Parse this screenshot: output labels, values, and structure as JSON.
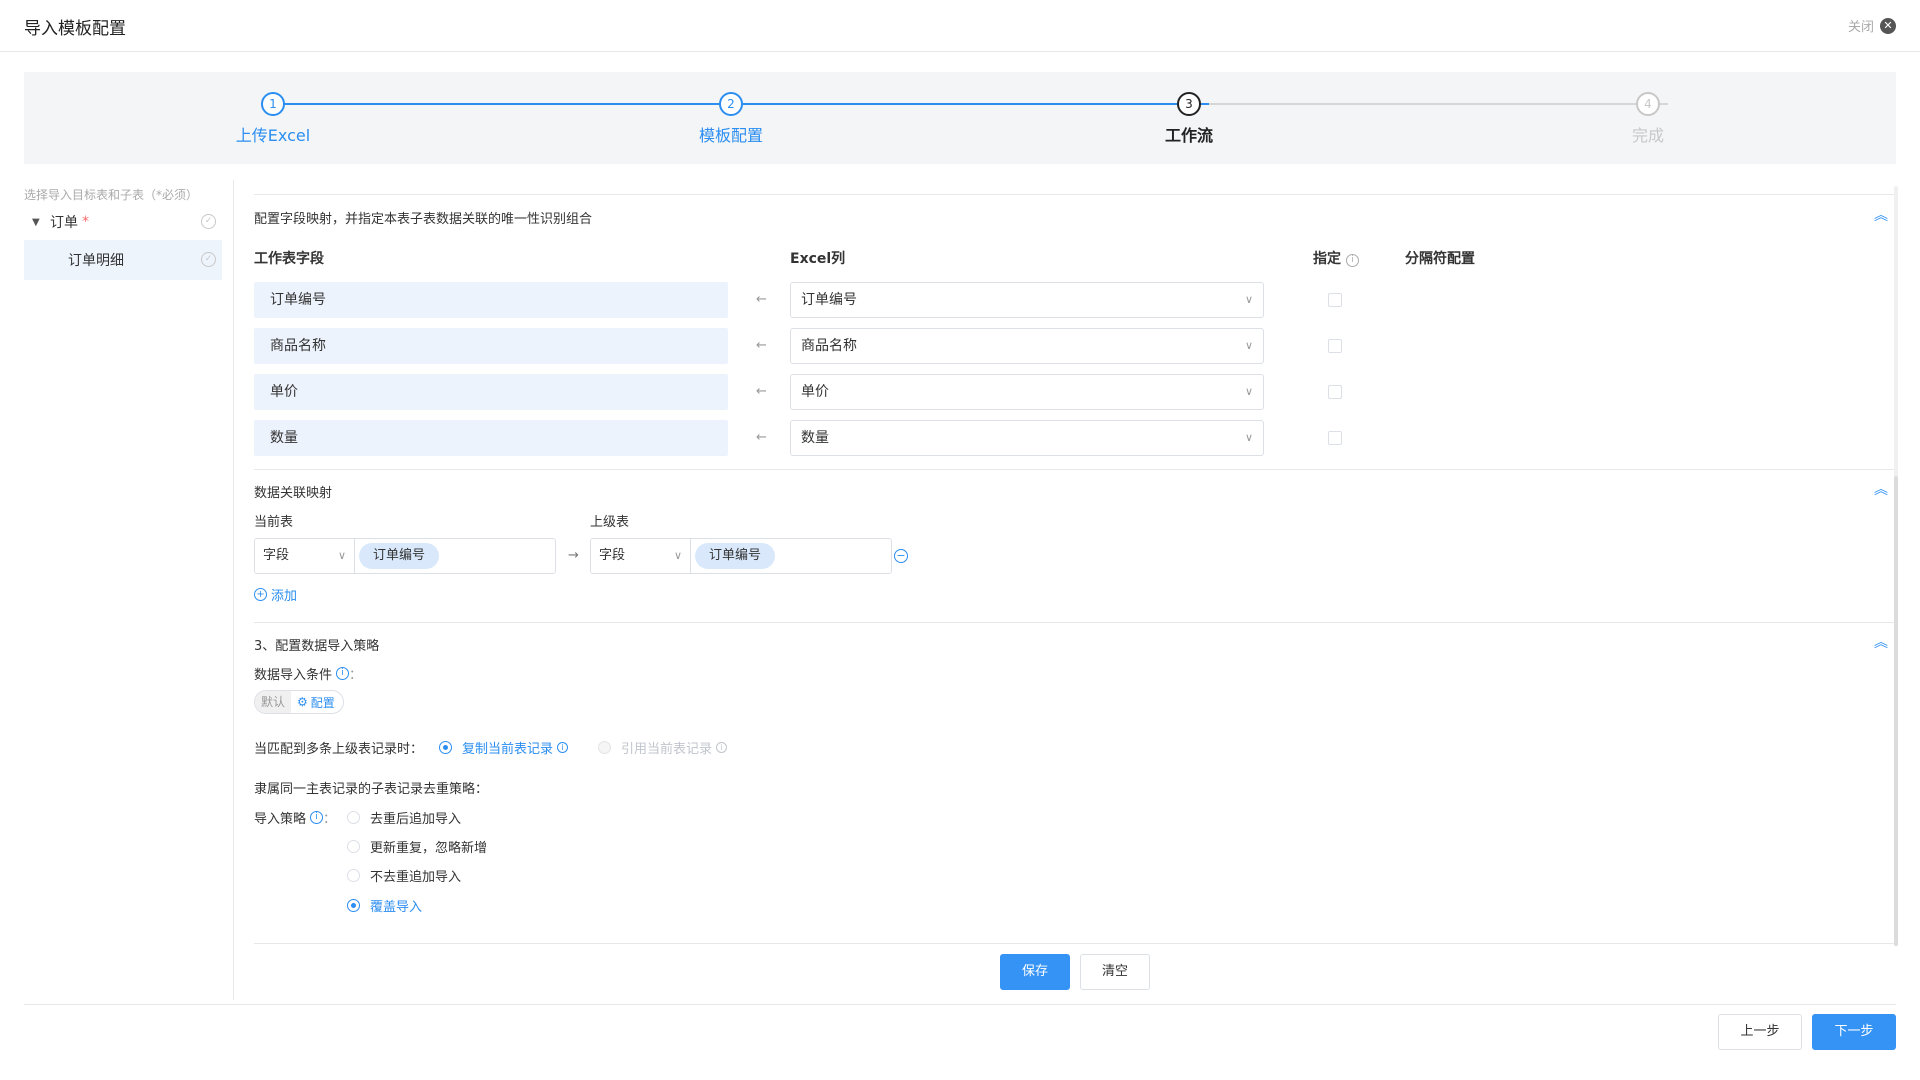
{
  "header": {
    "title": "导入模板配置",
    "close_label": "关闭",
    "close_icon": "close-circle-icon"
  },
  "steps": [
    {
      "num": "1",
      "label": "上传Excel",
      "state": "done"
    },
    {
      "num": "2",
      "label": "模板配置",
      "state": "done"
    },
    {
      "num": "3",
      "label": "工作流",
      "state": "current"
    },
    {
      "num": "4",
      "label": "完成",
      "state": "pending"
    }
  ],
  "left": {
    "hint": "选择导入目标表和子表（*必须）",
    "tree": [
      {
        "label": "订单",
        "required": "*"
      },
      {
        "label": "订单明细"
      }
    ]
  },
  "mapping": {
    "title": "配置字段映射，并指定本表子表数据关联的唯一性识别组合",
    "col_worktable": "工作表字段",
    "col_excel": "Excel列",
    "col_specify": "指定",
    "col_separator": "分隔符配置",
    "rows": [
      {
        "field": "订单编号",
        "excel": "订单编号"
      },
      {
        "field": "商品名称",
        "excel": "商品名称"
      },
      {
        "field": "单价",
        "excel": "单价"
      },
      {
        "field": "数量",
        "excel": "数量"
      }
    ]
  },
  "relation": {
    "title": "数据关联映射",
    "current_label": "当前表",
    "parent_label": "上级表",
    "current_select": "字段",
    "current_tag": "订单编号",
    "parent_select": "字段",
    "parent_tag": "订单编号",
    "add_label": "添加"
  },
  "strategy": {
    "title": "3、配置数据导入策略",
    "condition_label": "数据导入条件",
    "colon": "：",
    "badge_default": "默认",
    "badge_config": "配置",
    "multi_match_label": "当匹配到多条上级表记录时：",
    "opt_copy": "复制当前表记录",
    "opt_ref": "引用当前表记录",
    "dedupe_label": "隶属同一主表记录的子表记录去重策略：",
    "import_label": "导入策略",
    "options": [
      "去重后追加导入",
      "更新重复，忽略新增",
      "不去重追加导入",
      "覆盖导入"
    ],
    "selected": "覆盖导入"
  },
  "actions": {
    "save": "保存",
    "clear": "清空",
    "prev": "上一步",
    "next": "下一步"
  },
  "colors": {
    "accent": "#2b8ef0",
    "field_bg": "#edf3fc",
    "steps_bg": "#f4f5f7"
  }
}
